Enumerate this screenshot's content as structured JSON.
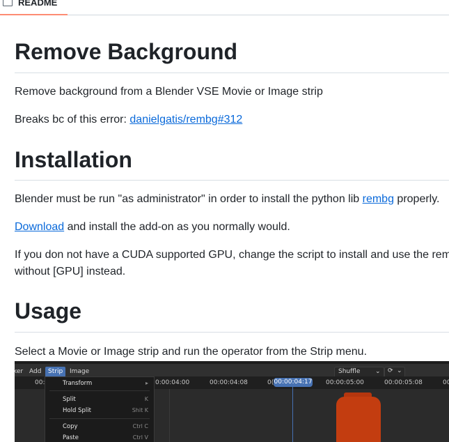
{
  "tab": {
    "label": "README",
    "icon": "book-icon"
  },
  "sections": {
    "remove_background": {
      "heading": "Remove Background",
      "p1": "Remove background from a Blender VSE Movie or Image strip",
      "p2_prefix": "Breaks bc of this error: ",
      "p2_link": "danielgatis/rembg#312"
    },
    "installation": {
      "heading": "Installation",
      "p1_prefix": "Blender must be run \"as administrator\" in order to install the python lib ",
      "p1_link": "rembg",
      "p1_suffix": " properly.",
      "p2_link": "Download",
      "p2_suffix": " and install the add-on as you normally would.",
      "p3_line1": "If you don not have a CUDA supported GPU, change the script to install and use the rem",
      "p3_line2": "without [GPU] instead."
    },
    "usage": {
      "heading": "Usage",
      "p1": "Select a Movie or Image strip and run the operator from the Strip menu."
    }
  },
  "screenshot": {
    "menubar": {
      "item_view": "ker",
      "item_add": "Add",
      "item_strip": "Strip",
      "item_image": "Image"
    },
    "dropdown_value": "Shuffle",
    "timeline": {
      "left_label": "00:",
      "ticks": [
        "0:00:04:00",
        "00:00:04:08",
        "0(",
        "00:00:05:00",
        "00:00:05:08",
        "00"
      ],
      "current": "00:00:04:17"
    },
    "strip_menu": {
      "transform": "Transform",
      "split": "Split",
      "split_shortcut": "K",
      "hold_split": "Hold Split",
      "hold_split_shortcut": "Shit K",
      "copy": "Copy",
      "copy_shortcut": "Ctrl C",
      "paste": "Paste",
      "paste_shortcut": "Ctrl V"
    }
  }
}
